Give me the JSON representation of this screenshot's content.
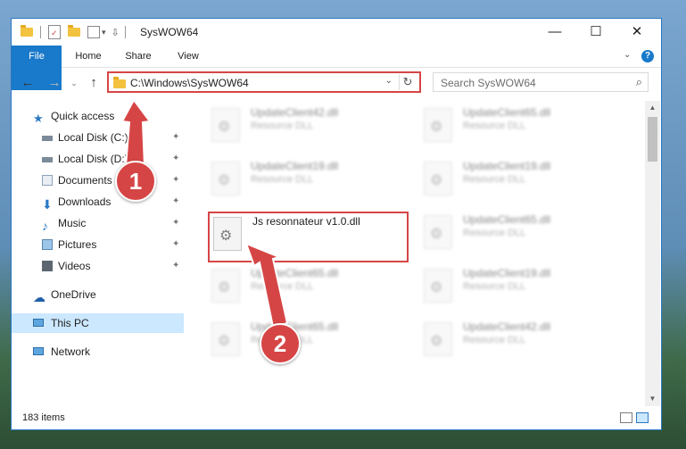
{
  "window": {
    "title": "SysWOW64"
  },
  "ribbon": {
    "tabs": [
      "File",
      "Home",
      "Share",
      "View"
    ],
    "help": "?"
  },
  "address": {
    "path": "C:\\Windows\\SysWOW64"
  },
  "search": {
    "placeholder": "Search SysWOW64"
  },
  "nav": {
    "quick_access": "Quick access",
    "items": [
      {
        "label": "Local Disk (C:)",
        "pinned": true
      },
      {
        "label": "Local Disk (D:)",
        "pinned": true
      },
      {
        "label": "Documents",
        "pinned": true
      },
      {
        "label": "Downloads",
        "pinned": true
      },
      {
        "label": "Music",
        "pinned": true
      },
      {
        "label": "Pictures",
        "pinned": true
      },
      {
        "label": "Videos",
        "pinned": true
      }
    ],
    "onedrive": "OneDrive",
    "this_pc": "This PC",
    "network": "Network"
  },
  "files": [
    {
      "name": "UpdateClient42.dll",
      "type": "Resource DLL"
    },
    {
      "name": "UpdateClient65.dll",
      "type": "Resource DLL"
    },
    {
      "name": "UpdateClient19.dll",
      "type": "Resource DLL"
    },
    {
      "name": "UpdateClient19.dll",
      "type": "Resource DLL"
    },
    {
      "name": "Js resonnateur v1.0.dll",
      "type": ""
    },
    {
      "name": "UpdateClient65.dll",
      "type": "Resource DLL"
    },
    {
      "name": "UpdateClient65.dll",
      "type": "Resource DLL"
    },
    {
      "name": "UpdateClient19.dll",
      "type": "Resource DLL"
    },
    {
      "name": "UpdateClient65.dll",
      "type": "Resource DLL"
    },
    {
      "name": "UpdateClient42.dll",
      "type": "Resource DLL"
    }
  ],
  "status": {
    "items": "183 items"
  },
  "callouts": [
    "1",
    "2"
  ],
  "colors": {
    "accent": "#1979ca",
    "highlight": "#d64545",
    "selected": "#cce8ff"
  }
}
